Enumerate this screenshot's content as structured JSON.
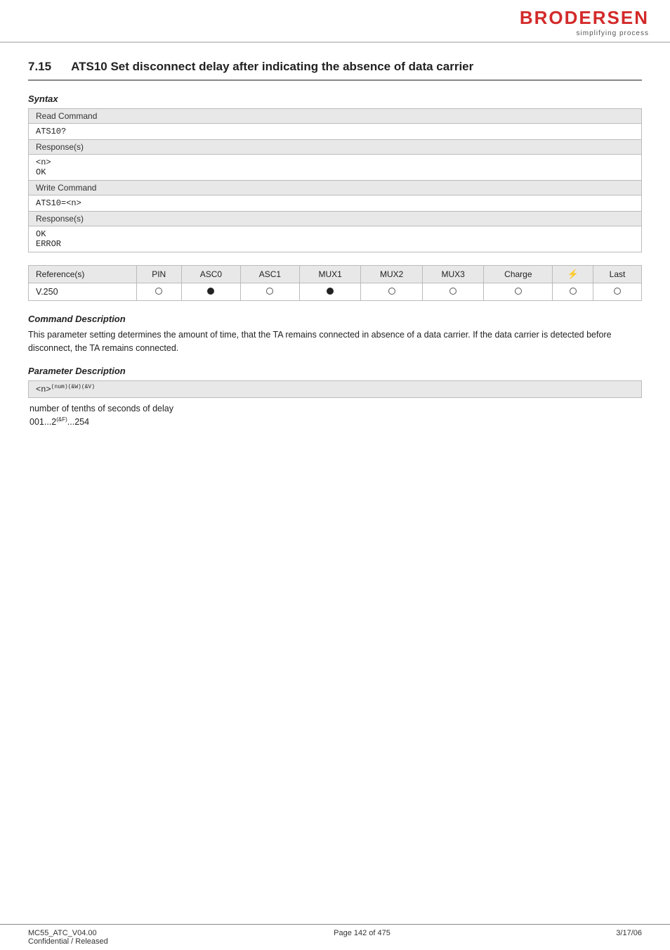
{
  "header": {
    "logo_text": "BRODERSEN",
    "logo_sub": "simplifying process"
  },
  "section": {
    "number": "7.15",
    "title": "ATS10   Set disconnect delay after indicating the absence of data carrier"
  },
  "syntax_label": "Syntax",
  "read_command": {
    "header": "Read Command",
    "command": "ATS10?",
    "response_header": "Response(s)",
    "responses": [
      "<n>",
      "OK"
    ]
  },
  "write_command": {
    "header": "Write Command",
    "command": "ATS10=<n>",
    "response_header": "Response(s)",
    "responses": [
      "OK",
      "ERROR"
    ]
  },
  "reference_table": {
    "columns": [
      "Reference(s)",
      "PIN",
      "ASC0",
      "ASC1",
      "MUX1",
      "MUX2",
      "MUX3",
      "Charge",
      "zz",
      "Last"
    ],
    "rows": [
      {
        "label": "V.250",
        "pin": "empty",
        "asc0": "filled",
        "asc1": "empty",
        "mux1": "filled",
        "mux2": "empty",
        "mux3": "empty",
        "charge": "empty",
        "zz": "empty",
        "last": "empty"
      }
    ]
  },
  "command_description": {
    "label": "Command Description",
    "text": "This parameter setting determines the amount of time, that the TA remains connected in absence of a data carrier. If the data carrier is detected before disconnect, the TA remains connected."
  },
  "parameter_description": {
    "label": "Parameter Description",
    "param_name": "<n>(num)(&W)(&V)",
    "param_text": "number of tenths of seconds of delay",
    "param_range": "001...2"
  },
  "param_range_superscript": "(&F)",
  "param_range_suffix": "...254",
  "footer": {
    "left_line1": "MC55_ATC_V04.00",
    "left_line2": "Confidential / Released",
    "center": "Page 142 of 475",
    "right": "3/17/06"
  }
}
